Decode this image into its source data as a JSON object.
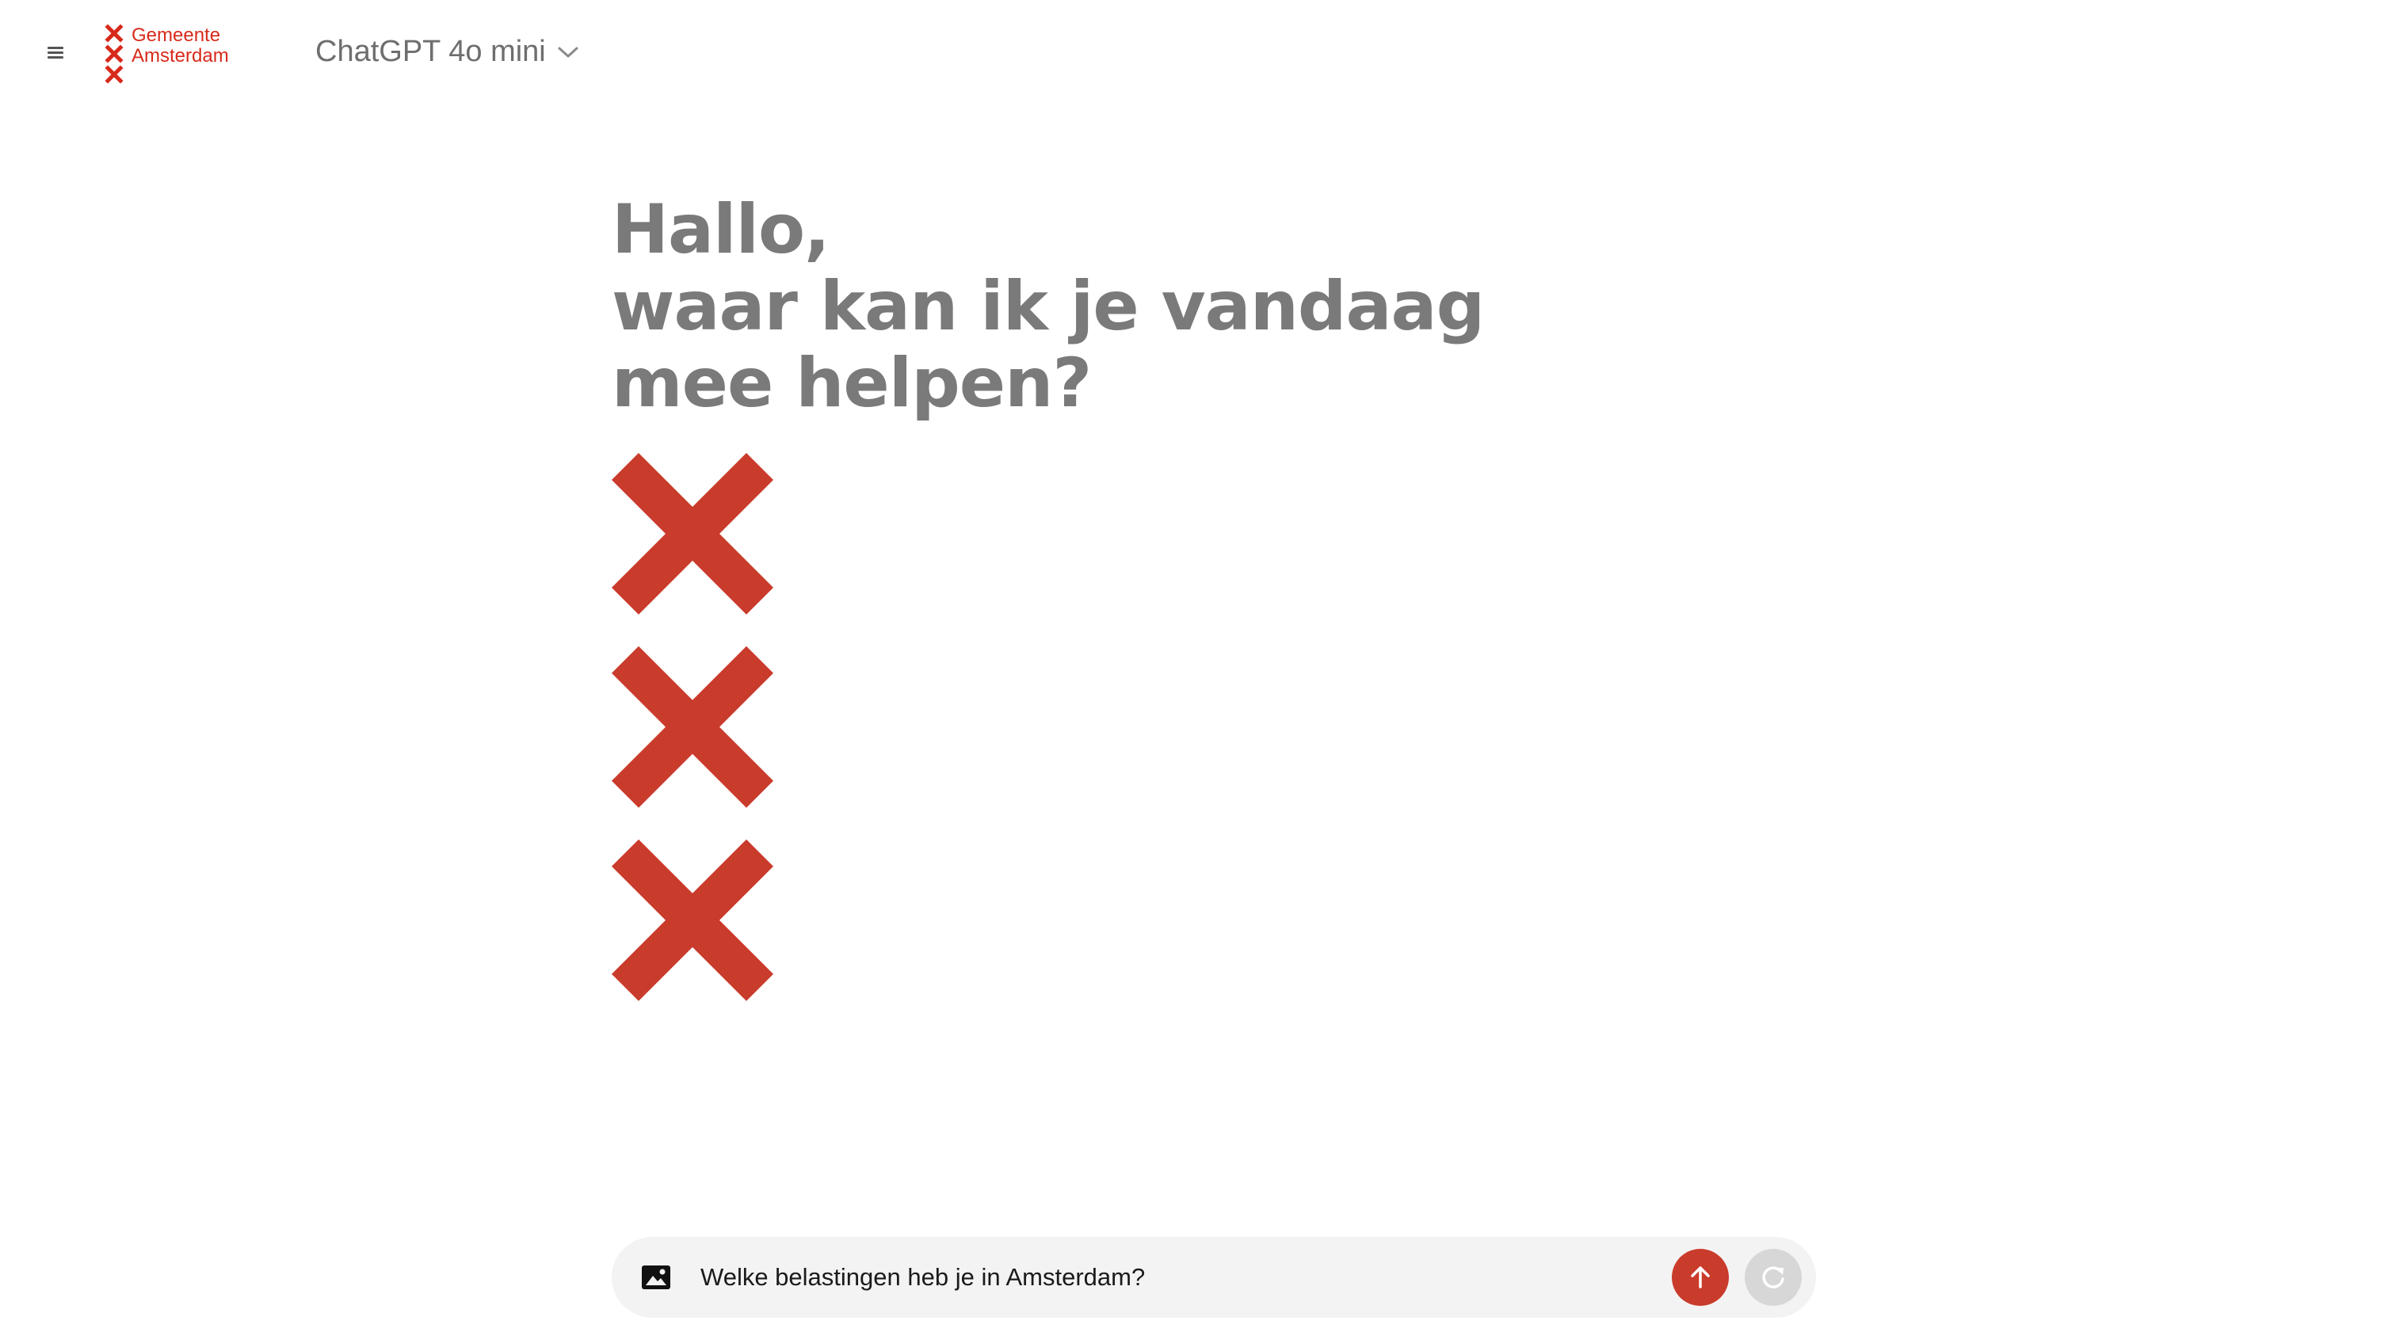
{
  "header": {
    "menu_icon": "hamburger-menu-icon",
    "logo": {
      "line1": "Gemeente",
      "line2": "Amsterdam",
      "color": "#d72a1b"
    },
    "model_selector": {
      "label": "ChatGPT 4o mini",
      "icon": "chevron-down-icon"
    }
  },
  "greeting": {
    "line1": "Hallo,",
    "line2": "waar kan ik je vandaag",
    "line3": "mee helpen?",
    "color": "#7a7a7a"
  },
  "emblem": {
    "icon": "andreas-cross-icon",
    "count": 3,
    "color": "#c93b2b"
  },
  "composer": {
    "image_icon": "image-upload-icon",
    "value": "Welke belastingen heb je in Amsterdam?",
    "send_icon": "arrow-up-icon",
    "send_color": "#c93b2b",
    "refresh_icon": "refresh-icon",
    "refresh_color": "#d7d7d7"
  }
}
